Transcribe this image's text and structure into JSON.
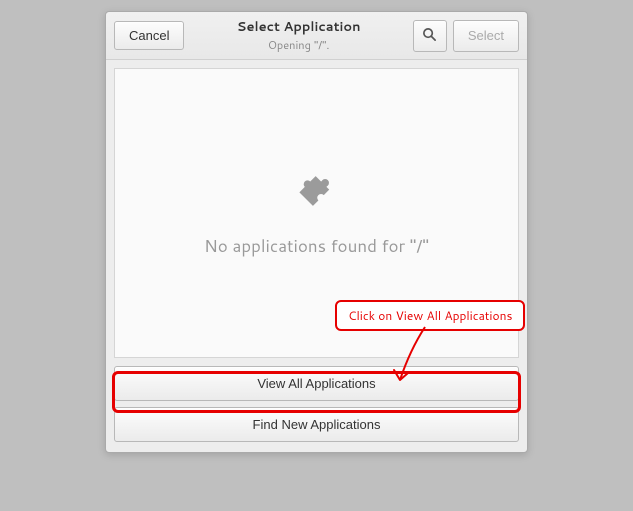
{
  "dialog": {
    "title": "Select Application",
    "subtitle": "Opening \"/\".",
    "cancel_label": "Cancel",
    "select_label": "Select"
  },
  "empty_state": {
    "message": "No applications found for \"/\""
  },
  "actions": {
    "view_all": "View All Applications",
    "find_new": "Find New Applications"
  },
  "annotation": {
    "text": "Click on View All Applications"
  },
  "icons": {
    "search": "search-icon",
    "puzzle": "puzzle-icon"
  }
}
